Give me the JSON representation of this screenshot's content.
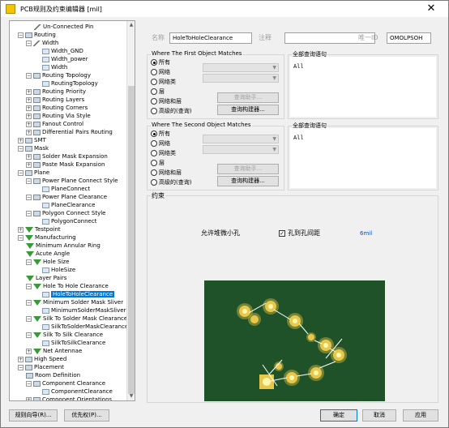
{
  "window": {
    "title": "PCB规则及约束编辑器 [mil]",
    "close_glyph": "✕"
  },
  "tree": {
    "items": [
      {
        "label": "Un-Connected Pin",
        "icon": "route-icon",
        "expand": ""
      },
      {
        "label": "Routing",
        "icon": "routing-icon",
        "expand": "−"
      },
      {
        "label": "Width",
        "icon": "width-icon",
        "expand": "−"
      },
      {
        "label": "Width_GND",
        "icon": "rule-icon",
        "expand": ""
      },
      {
        "label": "Width_power",
        "icon": "rule-icon",
        "expand": ""
      },
      {
        "label": "Width",
        "icon": "rule-icon",
        "expand": ""
      },
      {
        "label": "Routing Topology",
        "icon": "topology-icon",
        "expand": "−"
      },
      {
        "label": "RoutingTopology",
        "icon": "rule-icon",
        "expand": ""
      },
      {
        "label": "Routing Priority",
        "icon": "priority-icon",
        "expand": "+"
      },
      {
        "label": "Routing Layers",
        "icon": "layers-icon",
        "expand": "+"
      },
      {
        "label": "Routing Corners",
        "icon": "corners-icon",
        "expand": "+"
      },
      {
        "label": "Routing Via Style",
        "icon": "via-icon",
        "expand": "+"
      },
      {
        "label": "Fanout Control",
        "icon": "fanout-icon",
        "expand": "+"
      },
      {
        "label": "Differential Pairs Routing",
        "icon": "diffpair-icon",
        "expand": "+"
      },
      {
        "label": "SMT",
        "icon": "smt-icon",
        "expand": "+"
      },
      {
        "label": "Mask",
        "icon": "mask-icon",
        "expand": "−"
      },
      {
        "label": "Solder Mask Expansion",
        "icon": "mask-rule-icon",
        "expand": "+"
      },
      {
        "label": "Paste Mask Expansion",
        "icon": "mask-rule-icon",
        "expand": "+"
      },
      {
        "label": "Plane",
        "icon": "plane-icon",
        "expand": "−"
      },
      {
        "label": "Power Plane Connect Style",
        "icon": "plane-rule-icon",
        "expand": "−"
      },
      {
        "label": "PlaneConnect",
        "icon": "rule-icon",
        "expand": ""
      },
      {
        "label": "Power Plane Clearance",
        "icon": "plane-rule-icon",
        "expand": "−"
      },
      {
        "label": "PlaneClearance",
        "icon": "rule-icon",
        "expand": ""
      },
      {
        "label": "Polygon Connect Style",
        "icon": "plane-rule-icon",
        "expand": "−"
      },
      {
        "label": "PolygonConnect",
        "icon": "rule-icon",
        "expand": ""
      },
      {
        "label": "Testpoint",
        "icon": "testpoint-icon",
        "expand": "+"
      },
      {
        "label": "Manufacturing",
        "icon": "manufacturing-icon",
        "expand": "−"
      },
      {
        "label": "Minimum Annular Ring",
        "icon": "mfg-rule-icon",
        "expand": ""
      },
      {
        "label": "Acute Angle",
        "icon": "mfg-rule-icon",
        "expand": ""
      },
      {
        "label": "Hole Size",
        "icon": "mfg-rule-icon",
        "expand": "−"
      },
      {
        "label": "HoleSize",
        "icon": "rule-icon",
        "expand": ""
      },
      {
        "label": "Layer Pairs",
        "icon": "mfg-rule-icon",
        "expand": ""
      },
      {
        "label": "Hole To Hole Clearance",
        "icon": "mfg-rule-icon",
        "expand": "−"
      },
      {
        "label": "HoleToHoleClearance",
        "icon": "rule-icon",
        "expand": ""
      },
      {
        "label": "Minimum Solder Mask Sliver",
        "icon": "mfg-rule-icon",
        "expand": "−"
      },
      {
        "label": "MinimumSolderMaskSliver",
        "icon": "rule-icon",
        "expand": ""
      },
      {
        "label": "Silk To Solder Mask Clearance",
        "icon": "mfg-rule-icon",
        "expand": "−"
      },
      {
        "label": "SilkToSolderMaskClearance",
        "icon": "rule-icon",
        "expand": ""
      },
      {
        "label": "Silk To Silk Clearance",
        "icon": "mfg-rule-icon",
        "expand": "−"
      },
      {
        "label": "SilkToSilkClearance",
        "icon": "rule-icon",
        "expand": ""
      },
      {
        "label": "Net Antennae",
        "icon": "mfg-rule-icon",
        "expand": "+"
      },
      {
        "label": "High Speed",
        "icon": "highspeed-icon",
        "expand": "+"
      },
      {
        "label": "Placement",
        "icon": "placement-icon",
        "expand": "−"
      },
      {
        "label": "Room Definition",
        "icon": "placement-rule-icon",
        "expand": ""
      },
      {
        "label": "Component Clearance",
        "icon": "placement-rule-icon",
        "expand": "−"
      },
      {
        "label": "ComponentClearance",
        "icon": "rule-icon",
        "expand": ""
      },
      {
        "label": "Component Orientations",
        "icon": "placement-rule-icon",
        "expand": "+"
      }
    ],
    "selected_index": 33
  },
  "fields": {
    "name_label": "名称",
    "name_value": "HoleToHoleClearance",
    "comment_label": "注释",
    "comment_value": "",
    "id_label": "唯一ID",
    "id_value": "OMOLPSOH"
  },
  "first_match": {
    "title": "Where The First Object Matches",
    "options": [
      "所有",
      "网络",
      "网络类",
      "层",
      "网络和层",
      "高级的(查询)"
    ],
    "selected": 0,
    "helper_button": "查询助手...",
    "builder_button": "查询构建器...",
    "query_title": "全部查询语句",
    "query_text": "All"
  },
  "second_match": {
    "title": "Where The Second Object Matches",
    "options": [
      "所有",
      "网络",
      "网络类",
      "层",
      "网络和层",
      "高级的(查询)"
    ],
    "selected": 0,
    "helper_button": "查询助手...",
    "builder_button": "查询构建器...",
    "query_title": "全部查询语句",
    "query_text": "All"
  },
  "constraint": {
    "title": "约束",
    "allow_stacked_label": "允许堆微小孔",
    "hole_to_hole_label": "孔到孔间距",
    "hole_to_hole_value": "6mil",
    "canvas_color": "#1f5229",
    "pad_color": "#e8c84a"
  },
  "buttons": {
    "wizard": "规则向导(R)...",
    "priority": "优先权(P)...",
    "ok": "确定",
    "cancel": "取消",
    "apply": "应用"
  },
  "colors": {
    "selection": "#0078d7",
    "window_bg": "#f0f0f0"
  }
}
